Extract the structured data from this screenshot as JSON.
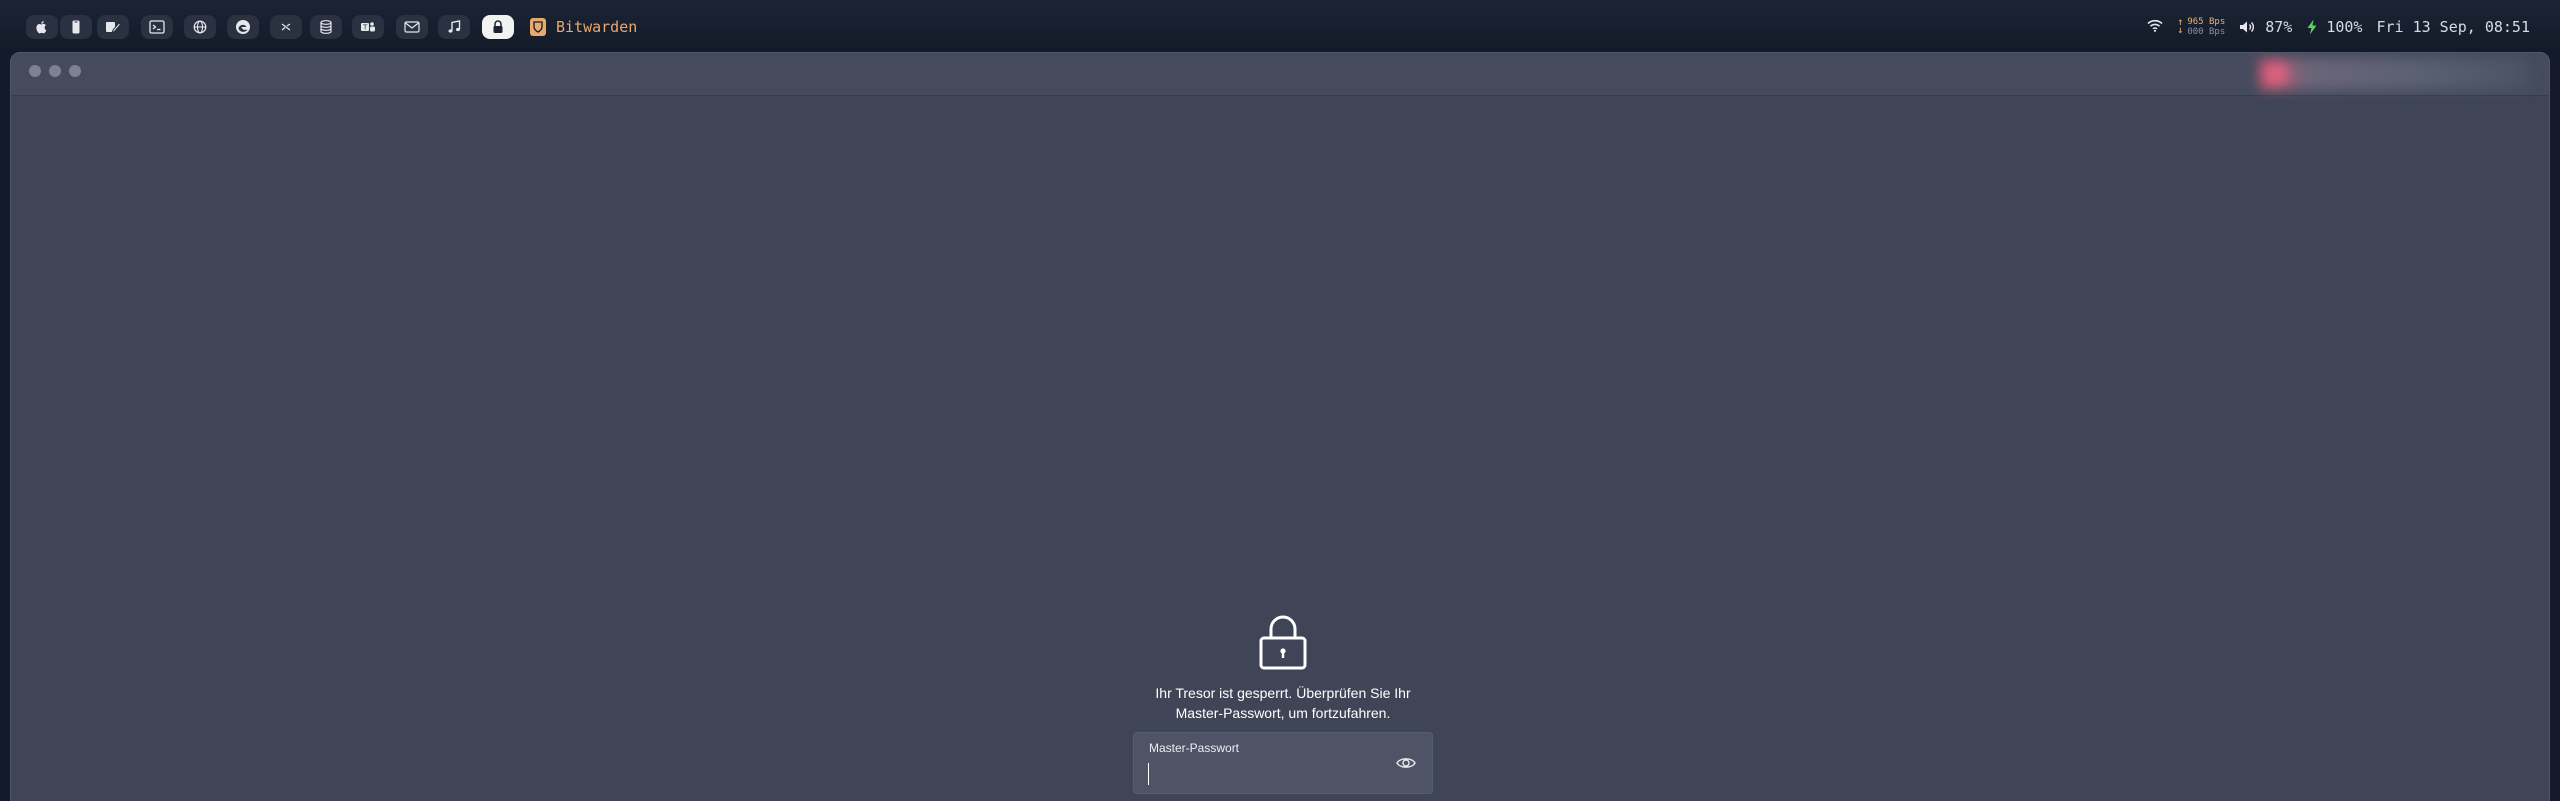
{
  "menubar": {
    "workspace_icons": [
      {
        "name": "apple-icon"
      },
      {
        "name": "phone-icon"
      },
      {
        "name": "pencil-icon"
      },
      {
        "name": "terminal-icon"
      },
      {
        "name": "globe-icon"
      },
      {
        "name": "edge-browser-icon"
      },
      {
        "name": "vscode-icon"
      },
      {
        "name": "database-icon"
      },
      {
        "name": "teams-icon"
      },
      {
        "name": "mail-icon"
      },
      {
        "name": "music-icon"
      },
      {
        "name": "lock-icon",
        "active": true
      }
    ],
    "active_app": "Bitwarden",
    "accent_color": "#e9a96a"
  },
  "status": {
    "net_up": "965 Bps",
    "net_down": "000 Bps",
    "volume": "87%",
    "battery": "100%",
    "datetime": "Fri 13 Sep, 08:51"
  },
  "lock_screen": {
    "message": "Ihr Tresor ist gesperrt. Überprüfen Sie Ihr Master-Passwort, um fortzufahren.",
    "password_label": "Master-Passwort",
    "password_value": ""
  }
}
